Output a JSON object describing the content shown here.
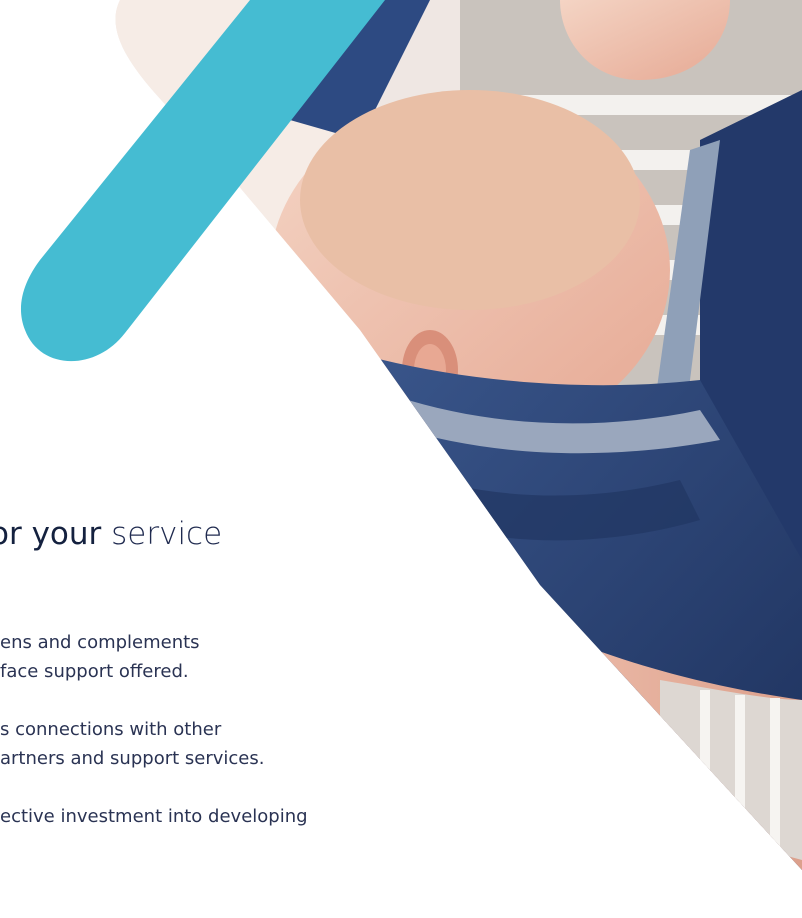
{
  "colors": {
    "accent": "#45bcd2",
    "navy": "#14213f",
    "text": "#2a3353",
    "background": "#ffffff"
  },
  "heading": {
    "strong": "or your",
    "light": " service"
  },
  "paragraphs": [
    {
      "line1": "ens and complements",
      "line2": "face support offered."
    },
    {
      "line1": "s connections with other",
      "line2": "artners and support services."
    },
    {
      "line1": "ective investment into developing",
      "line2": ""
    }
  ],
  "image": {
    "alt": "baby-in-carrier-photo"
  }
}
